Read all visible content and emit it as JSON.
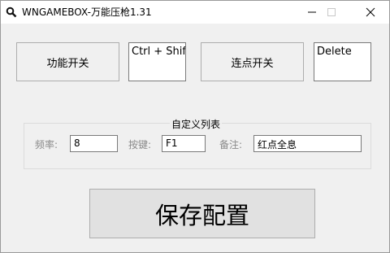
{
  "window": {
    "title": "WNGAMEBOX-万能压枪1.31",
    "icon": "magnifier-icon"
  },
  "controls": {
    "toggle_button_label": "功能开关",
    "toggle_hotkey_value": "Ctrl + Shif",
    "autoclick_button_label": "连点开关",
    "autoclick_hotkey_value": "Delete"
  },
  "custom_list": {
    "title": "自定义列表",
    "frequency_label": "频率:",
    "frequency_value": "8",
    "key_label": "按键:",
    "key_value": "F1",
    "note_label": "备注:",
    "note_value": "红点全息"
  },
  "save_button_label": "保存配置"
}
